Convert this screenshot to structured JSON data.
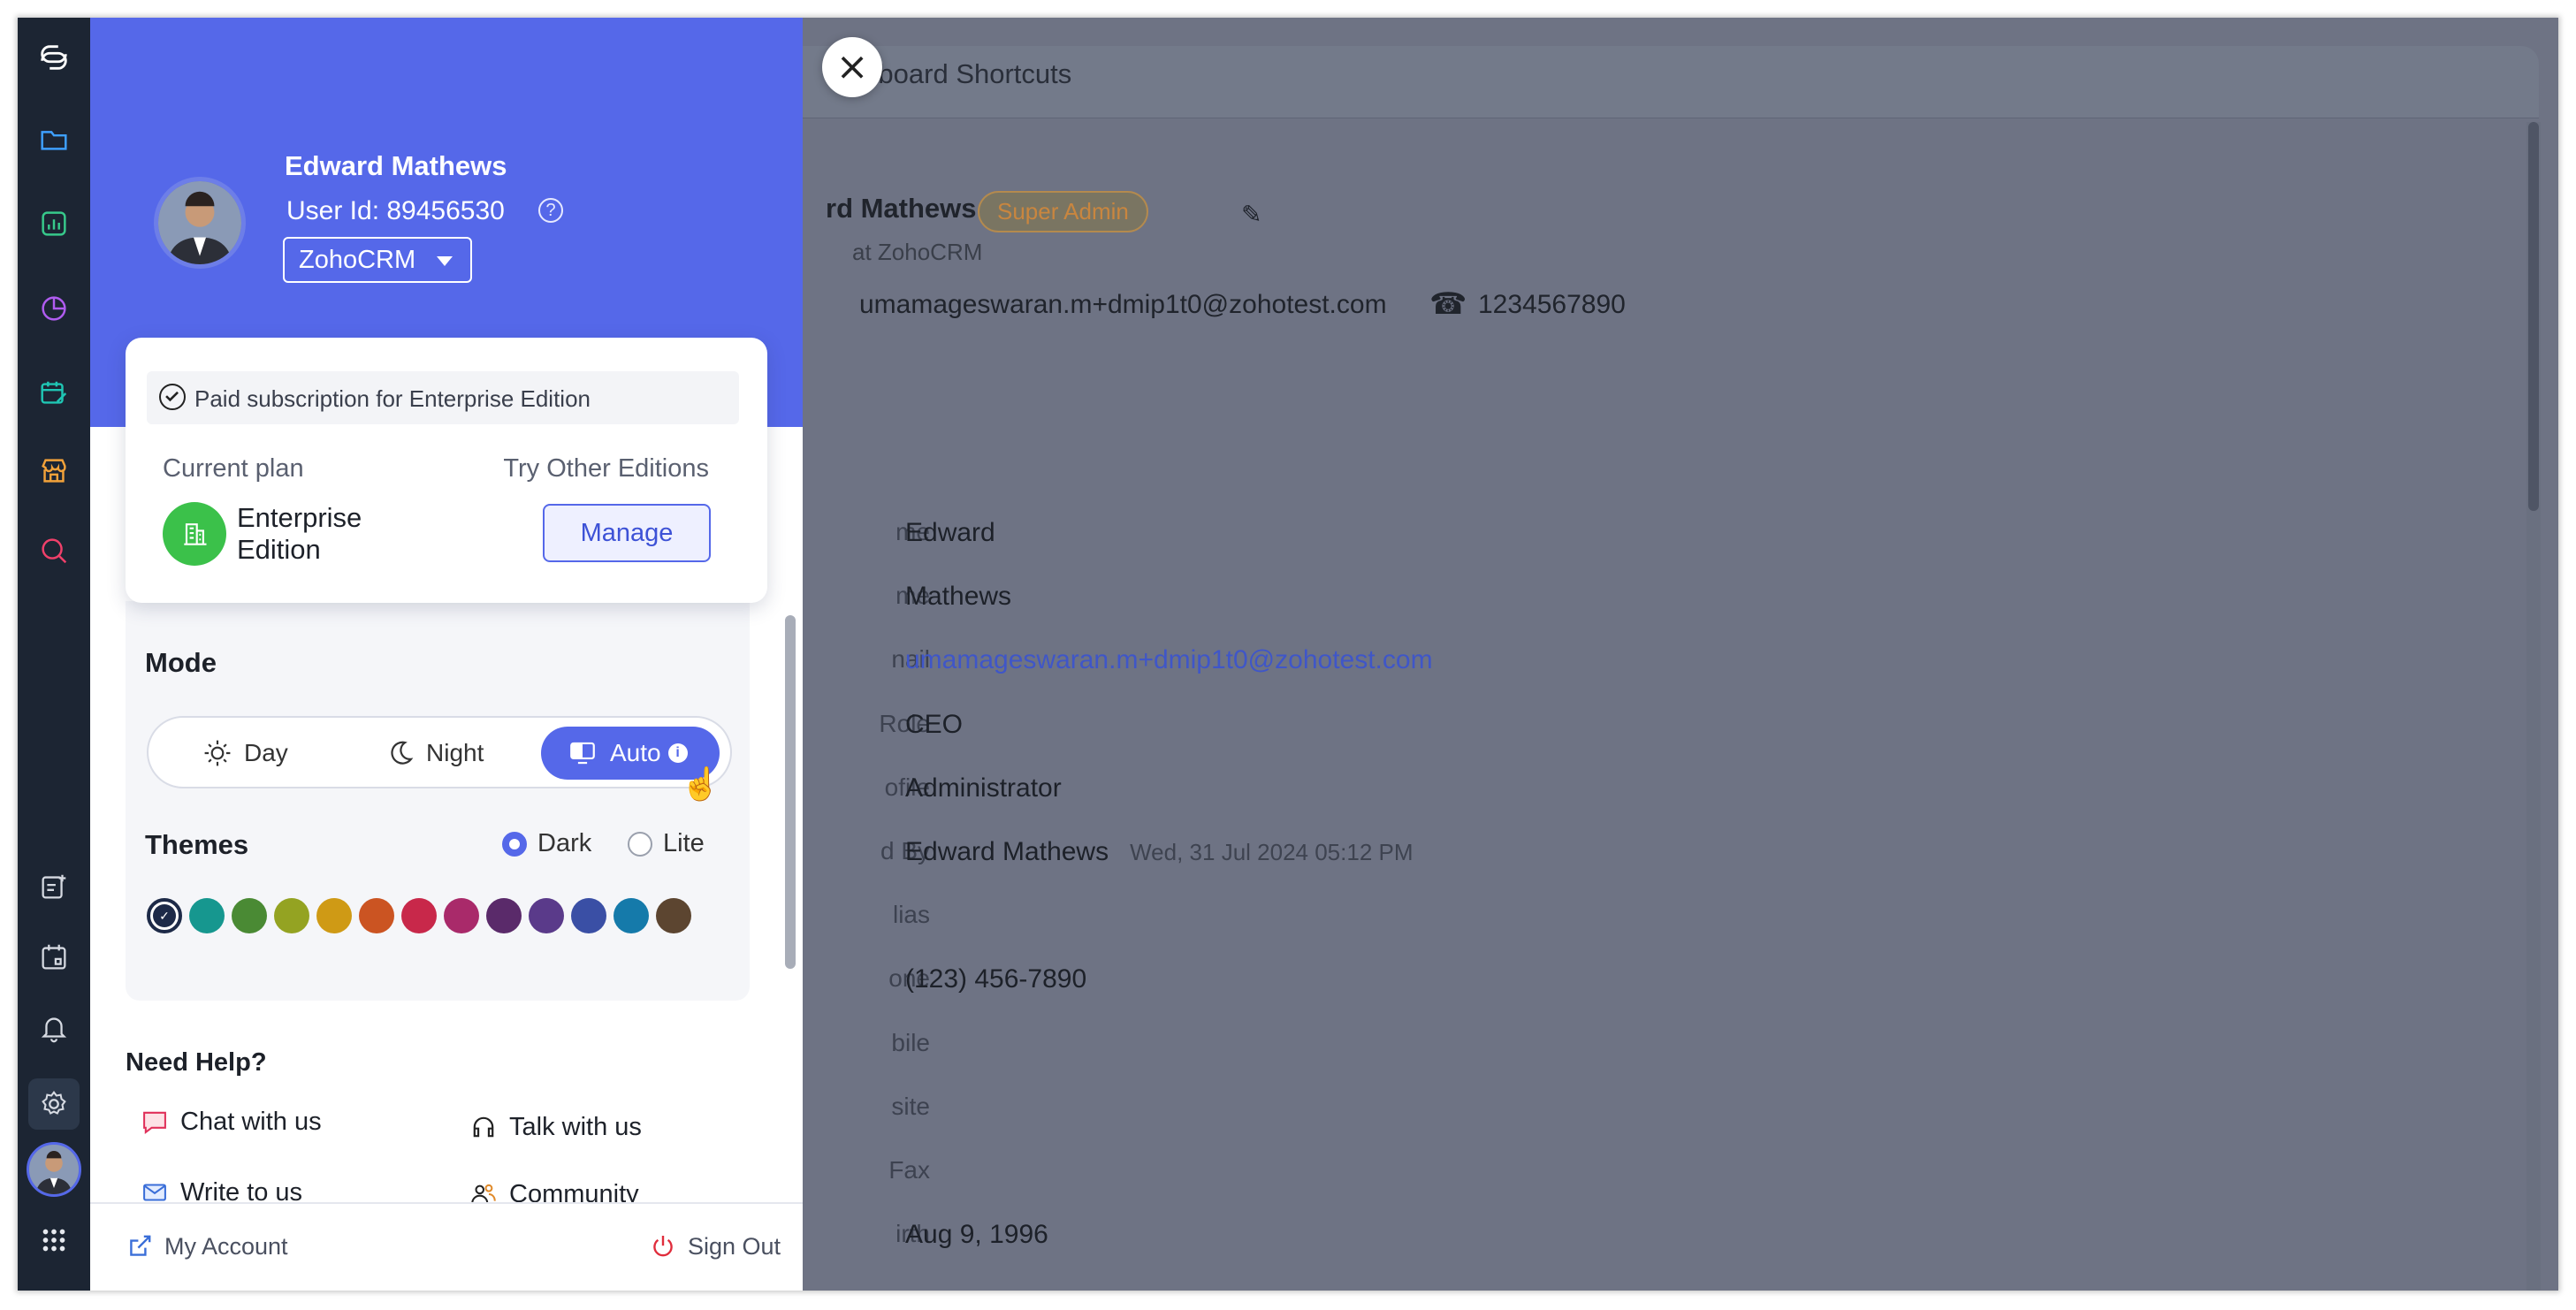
{
  "background": {
    "tab_label": "Keyboard Shortcuts",
    "tab_label_visible": "Keyboard Shortcuts",
    "profile_name": "rd Mathews",
    "role_badge": "Super Admin",
    "org_line": "at ZohoCRM",
    "email_top": "umamageswaran.m+dmip1t0@zohotest.com",
    "phone_top": "1234567890",
    "fields": [
      {
        "label": "me",
        "value": "Edward"
      },
      {
        "label": "me",
        "value": "Mathews"
      },
      {
        "label": "nail",
        "value": "umamageswaran.m+dmip1t0@zohotest.com",
        "link": true
      },
      {
        "label": "Role",
        "value": "CEO"
      },
      {
        "label": "ofile",
        "value": "Administrator"
      },
      {
        "label": "d By",
        "value": "Edward Mathews",
        "date": "Wed, 31 Jul 2024 05:12 PM"
      },
      {
        "label": "lias",
        "value": ""
      },
      {
        "label": "one",
        "value": "(123) 456-7890"
      },
      {
        "label": "bile",
        "value": ""
      },
      {
        "label": "site",
        "value": ""
      },
      {
        "label": "Fax",
        "value": ""
      },
      {
        "label": "irth",
        "value": "Aug 9, 1996"
      }
    ]
  },
  "panel": {
    "user_name": "Edward Mathews",
    "user_id": "User Id: 89456530",
    "org": "ZohoCRM",
    "subscription_note": "Paid subscription for Enterprise Edition",
    "current_plan_label": "Current plan",
    "try_other_label": "Try Other Editions",
    "plan_name": "Enterprise Edition",
    "manage_label": "Manage",
    "mode_title": "Mode",
    "mode_options": [
      "Day",
      "Night",
      "Auto"
    ],
    "mode_selected": "Auto",
    "themes_title": "Themes",
    "theme_dark": "Dark",
    "theme_lite": "Lite",
    "theme_selected": "Dark",
    "swatches": [
      "#1d2a48",
      "#16978f",
      "#4a8a34",
      "#94a322",
      "#cf9a15",
      "#cb5422",
      "#c8284a",
      "#a92a6a",
      "#5a2a6a",
      "#5a3a8a",
      "#3a4fa5",
      "#157aaa",
      "#5c4530"
    ],
    "help_title": "Need Help?",
    "help_items": [
      "Chat with us",
      "Talk with us",
      "Write to us",
      "Community"
    ],
    "my_account": "My Account",
    "sign_out": "Sign Out"
  },
  "colors": {
    "accent": "#5568e9",
    "sign_out": "#e02d3c",
    "plan_badge": "#3bc14a"
  }
}
